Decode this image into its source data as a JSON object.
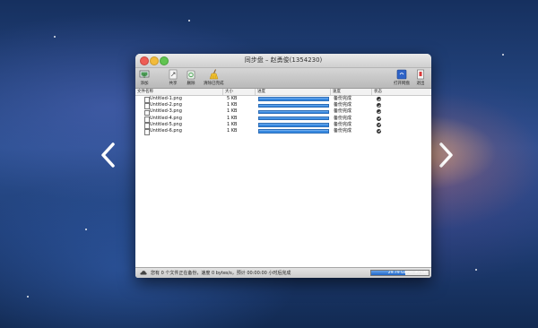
{
  "window": {
    "title": "同步盘 – 赵勇俊(1354230)"
  },
  "toolbar": {
    "left": [
      {
        "label": "添加",
        "icon": "add-folder-icon"
      },
      {
        "label": "共享",
        "icon": "share-icon"
      },
      {
        "label": "删除",
        "icon": "trash-icon"
      },
      {
        "label": "清除已完成",
        "icon": "broom-icon"
      }
    ],
    "right": [
      {
        "label": "打开网盘",
        "icon": "open-disk-icon"
      },
      {
        "label": "退出",
        "icon": "exit-icon"
      }
    ]
  },
  "table": {
    "headers": [
      "文件名称",
      "大小",
      "进度",
      "速度",
      "状态"
    ],
    "rows": [
      {
        "name": "Untitled-1.png",
        "size": "5 KB",
        "progress": 1.0,
        "speed": "备份完成"
      },
      {
        "name": "Untitled-2.png",
        "size": "1 KB",
        "progress": 1.0,
        "speed": "备份完成"
      },
      {
        "name": "Untitled-3.png",
        "size": "1 KB",
        "progress": 1.0,
        "speed": "备份完成"
      },
      {
        "name": "Untitled-4.png",
        "size": "1 KB",
        "progress": 1.0,
        "speed": "备份完成"
      },
      {
        "name": "Untitled-5.png",
        "size": "1 KB",
        "progress": 1.0,
        "speed": "备份完成"
      },
      {
        "name": "Untitled-6.png",
        "size": "1 KB",
        "progress": 1.0,
        "speed": "备份完成"
      }
    ]
  },
  "status": {
    "text": "您有 0 个文件正在备份，速度 0 bytes/s，预计 00:00:00 小时后完成",
    "storage_text": "29.79 GB/50.80 GB",
    "storage_used_fraction": 0.586
  },
  "colors": {
    "accent": "#2f82dc",
    "check": "#333333"
  }
}
